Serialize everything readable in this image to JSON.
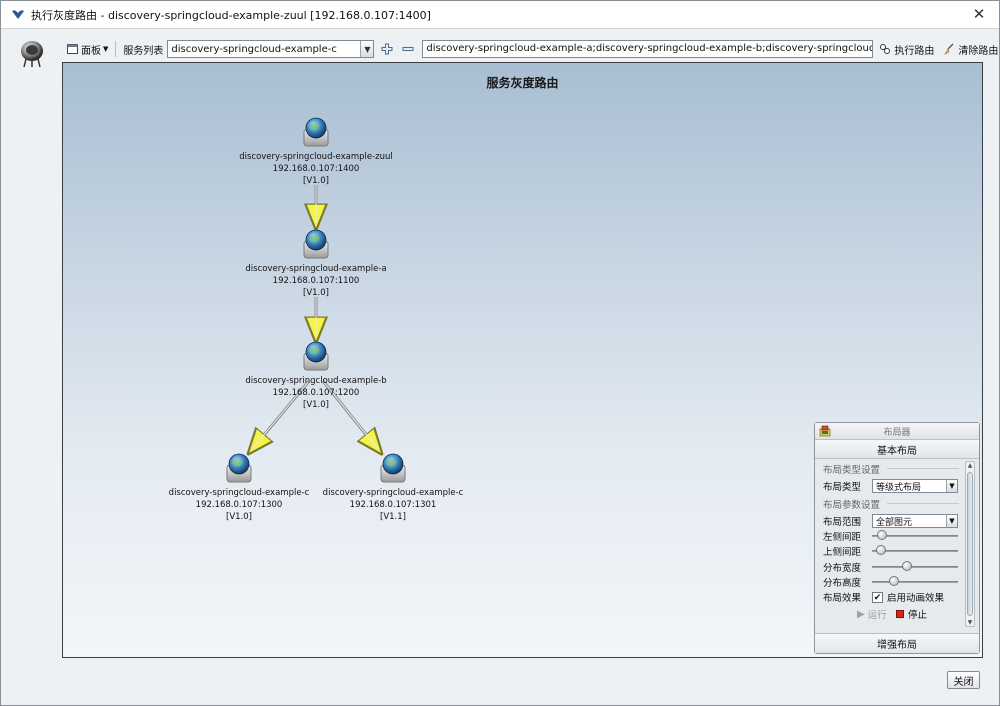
{
  "window": {
    "title": "执行灰度路由 - discovery-springcloud-example-zuul [192.168.0.107:1400]",
    "close_glyph": "✕"
  },
  "toolbar": {
    "panel_label": "面板",
    "service_list_label": "服务列表",
    "service_select_value": "discovery-springcloud-example-c",
    "route_value": "discovery-springcloud-example-a;discovery-springcloud-example-b;discovery-springcloud-example-c",
    "execute_label": "执行路由",
    "clear_label": "清除路由"
  },
  "canvas": {
    "title": "服务灰度路由",
    "nodes": [
      {
        "name": "discovery-springcloud-example-zuul",
        "address": "192.168.0.107:1400",
        "version": "[V1.0]"
      },
      {
        "name": "discovery-springcloud-example-a",
        "address": "192.168.0.107:1100",
        "version": "[V1.0]"
      },
      {
        "name": "discovery-springcloud-example-b",
        "address": "192.168.0.107:1200",
        "version": "[V1.0]"
      },
      {
        "name": "discovery-springcloud-example-c",
        "address": "192.168.0.107:1300",
        "version": "[V1.0]"
      },
      {
        "name": "discovery-springcloud-example-c",
        "address": "192.168.0.107:1301",
        "version": "[V1.1]"
      }
    ]
  },
  "layouter": {
    "title": "布局器",
    "basic_tab": "基本布局",
    "type_group": "布局类型设置",
    "type_label": "布局类型",
    "type_value": "等级式布局",
    "param_group": "布局参数设置",
    "range_label": "布局范围",
    "range_value": "全部图元",
    "left_gap_label": "左侧间距",
    "left_gap_level": 0.06,
    "top_gap_label": "上侧间距",
    "top_gap_level": 0.05,
    "width_label": "分布宽度",
    "width_level": 0.4,
    "height_label": "分布高度",
    "height_level": 0.22,
    "effect_label": "布局效果",
    "animation_label": "启用动画效果",
    "animation_checked": true,
    "run_label": "运行",
    "stop_label": "停止",
    "enhanced_tab": "增强布局"
  },
  "footer": {
    "close_label": "关闭"
  },
  "colors": {
    "node_globe": "#3f8cc8",
    "edge": "#8d8d8d",
    "arrow_fill": "#f3f34a",
    "stop_red": "#d9261c"
  }
}
